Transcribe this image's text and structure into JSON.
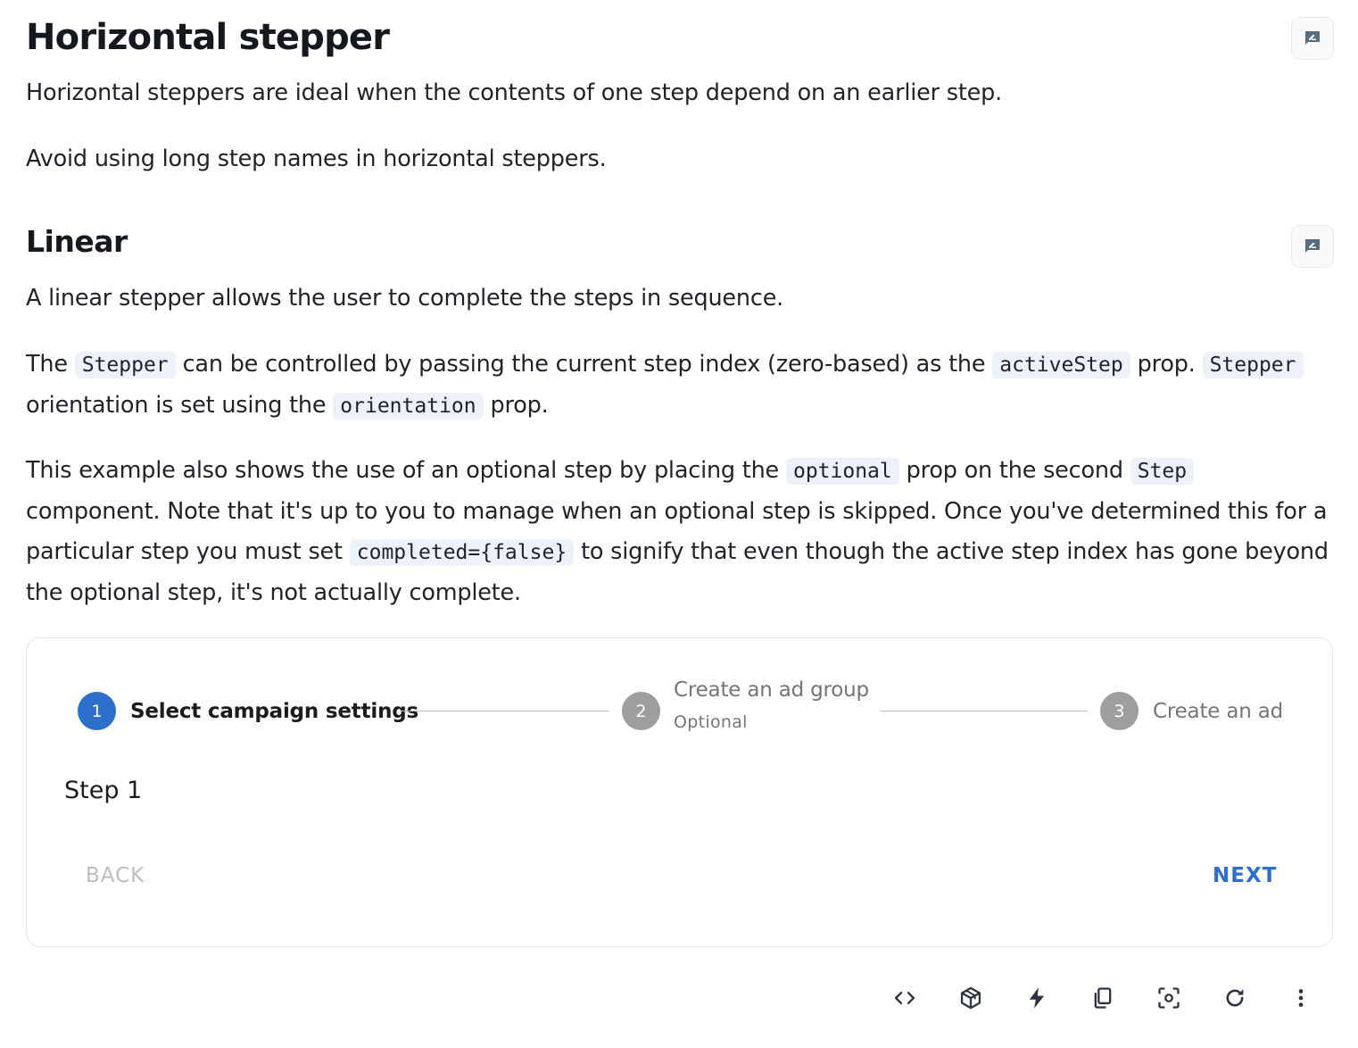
{
  "header": {
    "title": "Horizontal stepper",
    "intro": "Horizontal steppers are ideal when the contents of one step depend on an earlier step.",
    "note": "Avoid using long step names in horizontal steppers."
  },
  "linear": {
    "title": "Linear",
    "p1": "A linear stepper allows the user to complete the steps in sequence.",
    "p2": {
      "t1": "The ",
      "c1": "Stepper",
      "t2": " can be controlled by passing the current step index (zero-based) as the ",
      "c2": "activeStep",
      "t3": " prop. ",
      "c3": "Stepper",
      "t4": " orientation is set using the ",
      "c4": "orientation",
      "t5": " prop."
    },
    "p3": {
      "t1": "This example also shows the use of an optional step by placing the ",
      "c1": "optional",
      "t2": " prop on the second ",
      "c2": "Step",
      "t3": " component. Note that it's up to you to manage when an optional step is skipped. Once you've determined this for a particular step you must set ",
      "c3": "completed={false}",
      "t4": " to signify that even though the active step index has gone beyond the optional step, it's not actually complete."
    }
  },
  "demo": {
    "steps": [
      {
        "number": "1",
        "label": "Select campaign settings",
        "state": "active"
      },
      {
        "number": "2",
        "label": "Create an ad group",
        "optional": "Optional",
        "state": "inactive"
      },
      {
        "number": "3",
        "label": "Create an ad",
        "state": "inactive"
      }
    ],
    "content": "Step 1",
    "back_label": "BACK",
    "next_label": "NEXT"
  },
  "colors": {
    "accent": "#2f6fcc",
    "inactive_step": "#9e9e9e",
    "code_bg": "#edf2fa"
  },
  "toolbar": {
    "icons": [
      "code-icon",
      "package-icon",
      "bolt-icon",
      "copy-icon",
      "screenshot-icon",
      "refresh-icon",
      "more-vert-icon"
    ]
  }
}
